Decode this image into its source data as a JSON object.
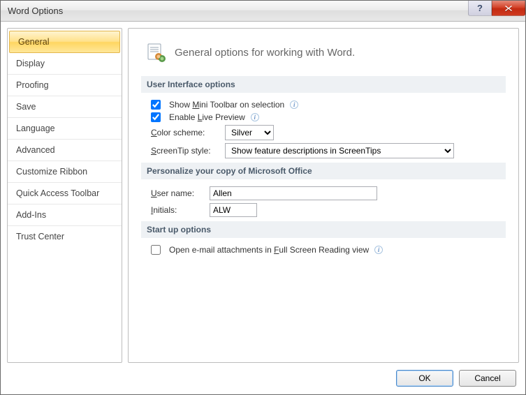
{
  "window": {
    "title": "Word Options"
  },
  "sidebar": {
    "items": [
      {
        "label": "General",
        "selected": true
      },
      {
        "label": "Display"
      },
      {
        "label": "Proofing"
      },
      {
        "label": "Save"
      },
      {
        "label": "Language"
      },
      {
        "label": "Advanced"
      },
      {
        "label": "Customize Ribbon"
      },
      {
        "label": "Quick Access Toolbar"
      },
      {
        "label": "Add-Ins"
      },
      {
        "label": "Trust Center"
      }
    ]
  },
  "heading": "General options for working with Word.",
  "sections": {
    "ui": {
      "title": "User Interface options",
      "mini_pre": "Show ",
      "mini_u": "M",
      "mini_post": "ini Toolbar on selection",
      "mini_checked": true,
      "live_pre": "Enable ",
      "live_u": "L",
      "live_post": "ive Preview",
      "live_checked": true,
      "color_label_u": "C",
      "color_label_post": "olor scheme:",
      "color_value": "Silver",
      "screentip_label_u": "S",
      "screentip_label_post": "creenTip style:",
      "screentip_value": "Show feature descriptions in ScreenTips"
    },
    "personalize": {
      "title": "Personalize your copy of Microsoft Office",
      "username_label_u": "U",
      "username_label_post": "ser name:",
      "username_value": "Allen",
      "initials_label_u": "I",
      "initials_label_post": "nitials:",
      "initials_value": "ALW"
    },
    "startup": {
      "title": "Start up options",
      "attach_pre": "Open e-mail attachments in ",
      "attach_u": "F",
      "attach_post": "ull Screen Reading view",
      "attach_checked": false
    }
  },
  "footer": {
    "ok": "OK",
    "cancel": "Cancel"
  }
}
